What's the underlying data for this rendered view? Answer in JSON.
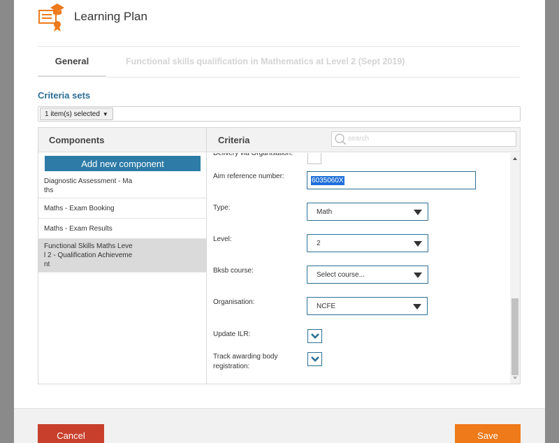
{
  "header": {
    "title": "Learning Plan",
    "icon": "learning-plan-icon"
  },
  "tabs": [
    {
      "label": "General",
      "active": true
    },
    {
      "label": "Functional skills qualification in Mathematics at Level 2 (Sept 2019)",
      "active": false
    }
  ],
  "criteria_sets": {
    "label": "Criteria sets",
    "selected": "1 item(s) selected"
  },
  "components": {
    "header": "Components",
    "add_button": "Add new component",
    "items": [
      {
        "label": "Diagnostic Assessment - Maths",
        "selected": false
      },
      {
        "label": "Maths - Exam Booking",
        "selected": false
      },
      {
        "label": "Maths - Exam Results",
        "selected": false
      },
      {
        "label": "Functional Skills Maths Level 2 - Qualification Achievement",
        "selected": true
      }
    ]
  },
  "criteria": {
    "header": "Criteria",
    "search_placeholder": "search",
    "fields": {
      "delivery_label": "Delivery via Organisation:",
      "aim_label": "Aim reference number:",
      "aim_value": "6035060X",
      "type_label": "Type:",
      "type_value": "Math",
      "level_label": "Level:",
      "level_value": "2",
      "bksb_label": "Bksb course:",
      "bksb_value": "Select course...",
      "org_label": "Organisation:",
      "org_value": "NCFE",
      "ilr_label": "Update ILR:",
      "track_label": "Track awarding body registration:"
    }
  },
  "footer": {
    "cancel_label": "Cancel",
    "save_label": "Save"
  },
  "colors": {
    "accent": "#2d7ba6",
    "cancel": "#c8402c",
    "save": "#ee7a1a",
    "title_blue": "#2c6e96"
  }
}
